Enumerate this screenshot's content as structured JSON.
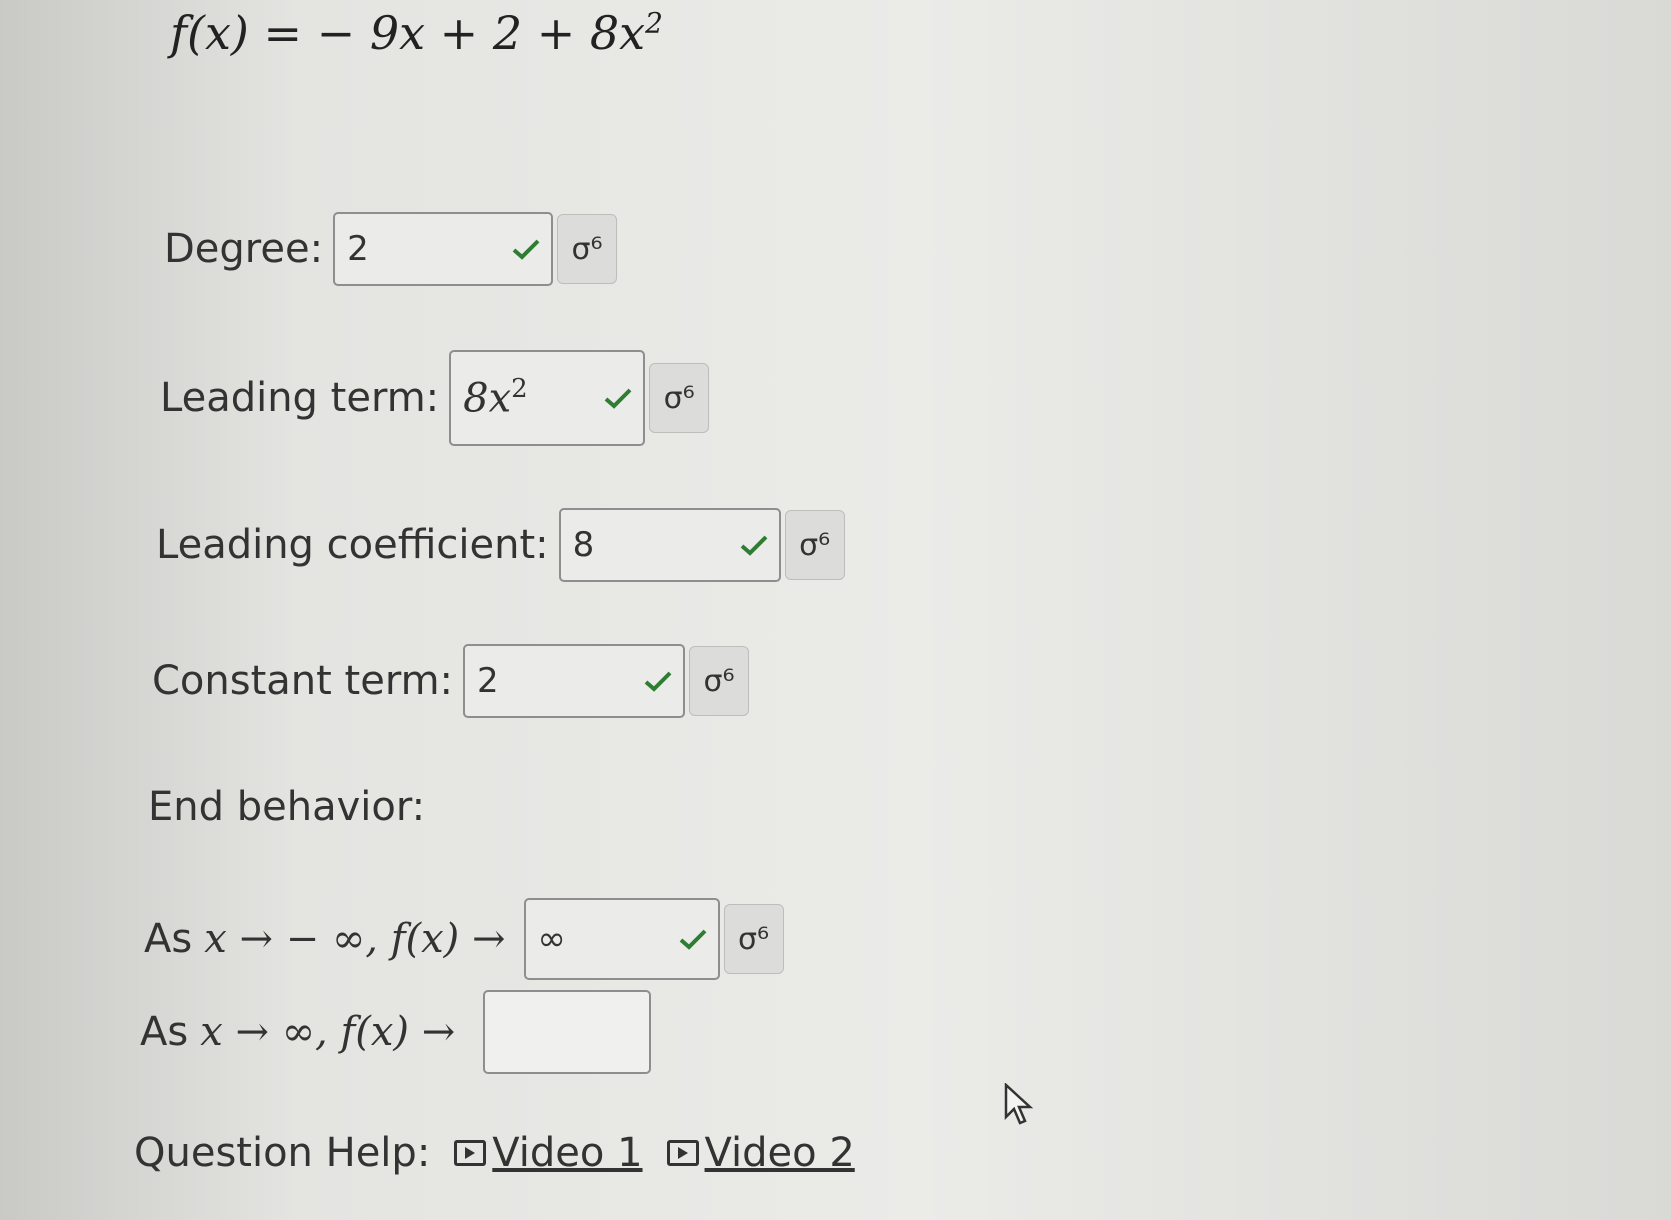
{
  "equation": {
    "lhs": "f(x) =",
    "rhs": "− 9x + 2 + 8x",
    "exponent": "2"
  },
  "fields": {
    "degree": {
      "label": "Degree:",
      "value": "2"
    },
    "leading_term": {
      "label": "Leading term:",
      "value": "8x",
      "exponent": "2"
    },
    "leading_coefficient": {
      "label": "Leading coefficient:",
      "value": "8"
    },
    "constant_term": {
      "label": "Constant term:",
      "value": "2"
    }
  },
  "end_behavior": {
    "heading": "End behavior:",
    "row1": {
      "prefix": "As",
      "condition": "x → − ∞, f(x) →",
      "value": "∞"
    },
    "row2": {
      "prefix": "As",
      "condition": "x → ∞, f(x) →",
      "value": ""
    }
  },
  "question_help": {
    "label": "Question Help:",
    "videos": [
      "Video 1",
      "Video 2"
    ]
  },
  "icons": {
    "check": "check-icon",
    "preview": "preview-formula-icon",
    "video": "video-icon",
    "cursor": "mouse-pointer-icon"
  },
  "colors": {
    "check": "#2e7d32",
    "text": "#333333"
  }
}
